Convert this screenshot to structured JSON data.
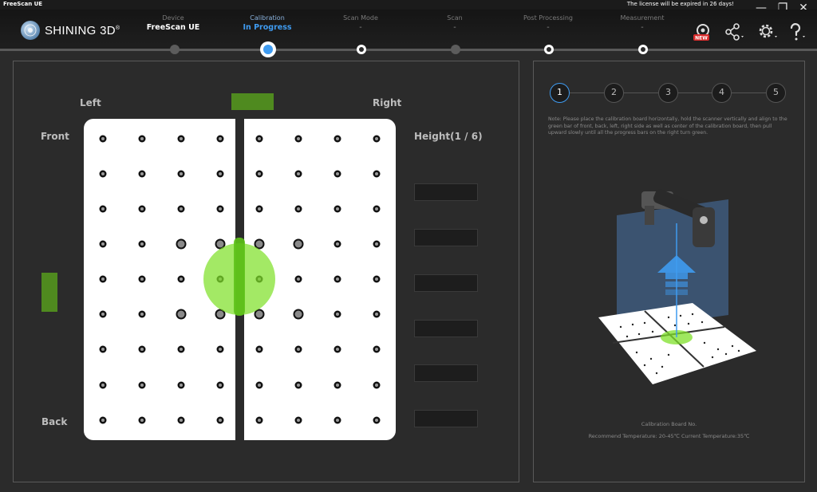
{
  "app": {
    "title": "FreeScan UE",
    "license_notice": "The license will be expired in 26 days!",
    "logo_text": "SHINING 3D",
    "logo_reg": "®"
  },
  "window_controls": {
    "minimize": "—",
    "restore": "❐",
    "close": "✕"
  },
  "workflow": [
    {
      "caption": "Device",
      "value": "FreeScan UE",
      "state": "done"
    },
    {
      "caption": "Calibration",
      "value": "In Progress",
      "state": "active"
    },
    {
      "caption": "Scan Mode",
      "value": "-",
      "state": "pending"
    },
    {
      "caption": "Scan",
      "value": "-",
      "state": "pending"
    },
    {
      "caption": "Post Processing",
      "value": "-",
      "state": "pending"
    },
    {
      "caption": "Measurement",
      "value": "-",
      "state": "pending"
    }
  ],
  "header_icons": {
    "new_badge": "NEW",
    "settings": "gear-icon",
    "share": "share-icon",
    "help": "help-icon"
  },
  "calibration": {
    "labels": {
      "left": "Left",
      "right": "Right",
      "front": "Front",
      "back": "Back",
      "height": "Height(1 / 6)"
    },
    "height_progress": [
      0,
      0,
      0,
      0,
      0,
      0
    ]
  },
  "steps": {
    "items": [
      "1",
      "2",
      "3",
      "4",
      "5"
    ],
    "active_index": 0
  },
  "instructions": {
    "note": "Note: Please place the calibration board horizontally, hold the scanner vertically and align to the green bar of front, back, left, right side as well as center of the calibration board, then pull upward slowly until all the progress bars on the right turn green.",
    "board_no": "Calibration Board No.",
    "temperature": "Recommend Temperature: 20-45℃ Current Temperature:35℃"
  },
  "colors": {
    "accent_blue": "#3f9bf0",
    "bar_green": "#4f8a1f",
    "bubble_green": "#7fe02a",
    "panel_bg": "#2b2b2b"
  }
}
